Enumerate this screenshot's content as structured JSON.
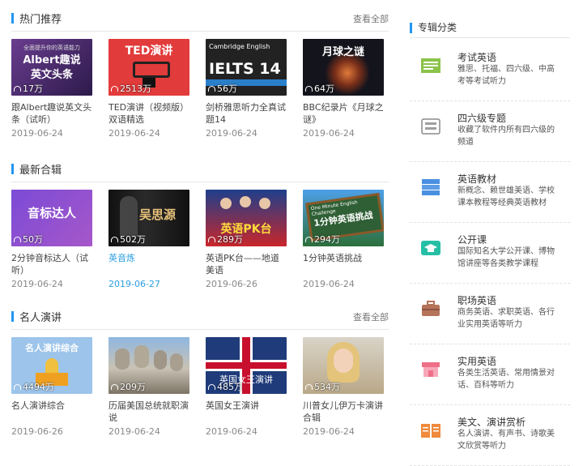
{
  "sections": {
    "hot": {
      "title": "热门推荐",
      "more": "查看全部",
      "cards": [
        {
          "thumb": "Albert趣说\n英文头条",
          "thumb_top": "全面提升你的英语能力",
          "plays": "17万",
          "title": "跟Albert趣说英文头条（试听）",
          "date": "2019-06-24"
        },
        {
          "thumb": "TED演讲",
          "plays": "2513万",
          "title": "TED演讲（视频版）双语精选",
          "date": "2019-06-24"
        },
        {
          "thumb": "IELTS 14",
          "thumb_top": "Cambridge English",
          "plays": "56万",
          "title": "剑桥雅思听力全真试题14",
          "date": "2019-06-24"
        },
        {
          "thumb": "月球之谜",
          "plays": "64万",
          "title": "BBC纪录片《月球之谜》",
          "date": "2019-06-24"
        }
      ]
    },
    "new": {
      "title": "最新合辑",
      "cards": [
        {
          "thumb": "音标达人",
          "plays": "50万",
          "title": "2分钟音标达人（试听）",
          "date": "2019-06-24"
        },
        {
          "thumb": "吴思源",
          "plays": "502万",
          "title": "英音炼",
          "date": "2019-06-27"
        },
        {
          "thumb": "英语PK台",
          "plays": "289万",
          "title": "英语PK台——地道美语",
          "date": "2019-06-26"
        },
        {
          "thumb": "1分钟英语挑战",
          "thumb_top": "One Minute English Challenge",
          "plays": "294万",
          "title": "1分钟英语挑战",
          "date": "2019-06-24"
        }
      ]
    },
    "speech": {
      "title": "名人演讲",
      "more": "查看全部",
      "cards": [
        {
          "thumb": "名人演讲综合",
          "plays": "4494万",
          "title": "名人演讲综合",
          "date": "2019-06-26"
        },
        {
          "thumb": "",
          "plays": "209万",
          "title": "历届美国总统就职演说",
          "date": "2019-06-24"
        },
        {
          "thumb": "英国女王演讲",
          "plays": "485万",
          "title": "英国女王演讲",
          "date": "2019-06-24"
        },
        {
          "thumb": "",
          "plays": "534万",
          "title": "川普女儿伊万卡演讲合辑",
          "date": "2019-06-24"
        }
      ]
    }
  },
  "sidebar": {
    "title": "专辑分类",
    "categories": [
      {
        "name": "考试英语",
        "desc": "雅思、托福、四六级、中高考等考试听力",
        "icon": "exam-paper-icon",
        "color": "#8bc34a"
      },
      {
        "name": "四六级专题",
        "desc": "收藏了软件内所有四六级的频道",
        "icon": "cet-badge-icon",
        "color": "#9e9e9e"
      },
      {
        "name": "英语教材",
        "desc": "新概念、赖世雄美语、学校课本教程等经典英语教材",
        "icon": "books-icon",
        "color": "#4a90e2"
      },
      {
        "name": "公开课",
        "desc": "国际知名大学公开课、博物馆讲座等各类教学课程",
        "icon": "graduation-cap-icon",
        "color": "#26bfa5"
      },
      {
        "name": "职场英语",
        "desc": "商务英语、求职英语、各行业实用英语等听力",
        "icon": "briefcase-icon",
        "color": "#b5735a"
      },
      {
        "name": "实用英语",
        "desc": "各类生活英语、常用情景对话、百科等听力",
        "icon": "shop-icon",
        "color": "#ef6f88"
      },
      {
        "name": "美文、演讲赏析",
        "desc": "名人演讲、有声书、诗歌美文欣赏等听力",
        "icon": "open-book-icon",
        "color": "#f08a3c"
      }
    ]
  }
}
